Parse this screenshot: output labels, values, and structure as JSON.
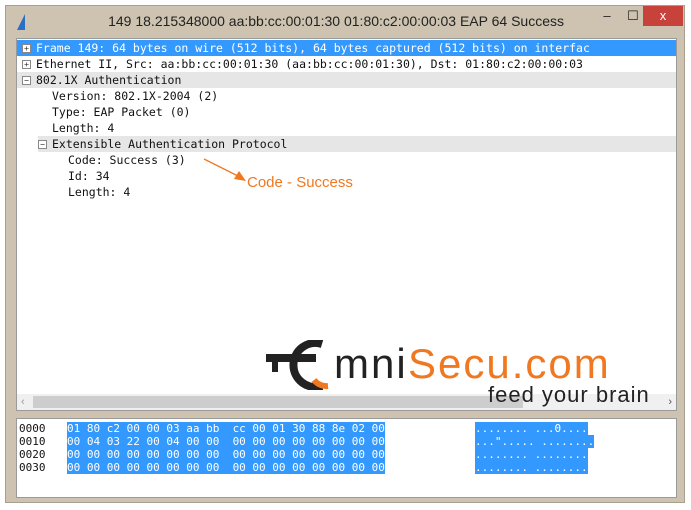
{
  "window": {
    "title": "149 18.215348000 aa:bb:cc:00:01:30 01:80:c2:00:00:03 EAP 64 Success",
    "minimize": "‒",
    "maximize": "☐",
    "close": "x"
  },
  "tree": [
    {
      "text": "Frame 149: 64 bytes on wire (512 bits), 64 bytes captured (512 bits) on interfac",
      "toggle": "+"
    },
    {
      "text": "Ethernet II, Src: aa:bb:cc:00:01:30 (aa:bb:cc:00:01:30), Dst: 01:80:c2:00:00:03",
      "toggle": "+"
    },
    {
      "text": "802.1X Authentication",
      "toggle": "−"
    },
    {
      "text": "Version: 802.1X-2004 (2)"
    },
    {
      "text": "Type: EAP Packet (0)"
    },
    {
      "text": "Length: 4"
    },
    {
      "text": "Extensible Authentication Protocol",
      "toggle": "−"
    },
    {
      "text": "Code: Success (3)"
    },
    {
      "text": "Id: 34"
    },
    {
      "text": "Length: 4"
    }
  ],
  "annotation": "Code - Success",
  "logo": {
    "text1": "mni",
    "text2": "Secu.com",
    "tagline": "feed your brain",
    "accent": "#f07820"
  },
  "hex": [
    {
      "off": "0000",
      "bytes": "01 80 c2 00 00 03 aa bb  cc 00 01 30 88 8e 02 00",
      "ascii": "........ ...0...."
    },
    {
      "off": "0010",
      "bytes": "00 04 03 22 00 04 00 00  00 00 00 00 00 00 00 00",
      "ascii": "...\"..... ........"
    },
    {
      "off": "0020",
      "bytes": "00 00 00 00 00 00 00 00  00 00 00 00 00 00 00 00",
      "ascii": "........ ........"
    },
    {
      "off": "0030",
      "bytes": "00 00 00 00 00 00 00 00  00 00 00 00 00 00 00 00",
      "ascii": "........ ........"
    }
  ]
}
